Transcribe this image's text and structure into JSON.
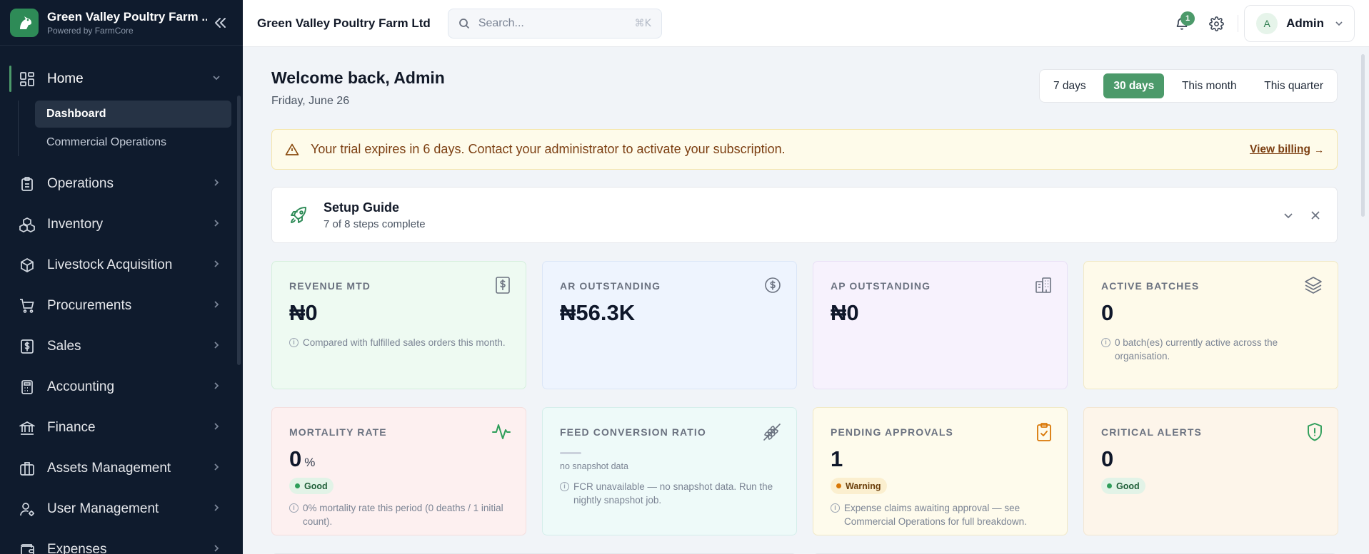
{
  "sidebar": {
    "brand_name": "Green Valley Poultry Farm ...",
    "brand_sub": "Powered by FarmCore",
    "items": [
      {
        "label": "Home"
      },
      {
        "label": "Operations"
      },
      {
        "label": "Inventory"
      },
      {
        "label": "Livestock Acquisition"
      },
      {
        "label": "Procurements"
      },
      {
        "label": "Sales"
      },
      {
        "label": "Accounting"
      },
      {
        "label": "Finance"
      },
      {
        "label": "Assets Management"
      },
      {
        "label": "User Management"
      },
      {
        "label": "Expenses"
      }
    ],
    "home_sub": [
      {
        "label": "Dashboard"
      },
      {
        "label": "Commercial Operations"
      }
    ]
  },
  "topbar": {
    "org_name": "Green Valley Poultry Farm Ltd",
    "search_placeholder": "Search...",
    "shortcut": "⌘K",
    "notification_count": "1",
    "avatar_initial": "A",
    "user_name": "Admin"
  },
  "welcome": {
    "title": "Welcome back, Admin",
    "date": "Friday, June 26"
  },
  "range": {
    "options": [
      "7 days",
      "30 days",
      "This month",
      "This quarter"
    ],
    "selected": "30 days"
  },
  "trial": {
    "message": "Your trial expires in 6 days. Contact your administrator to activate your subscription.",
    "link": "View billing",
    "arrow": "→"
  },
  "guide": {
    "title": "Setup Guide",
    "subtitle": "7 of 8 steps complete"
  },
  "cards": [
    {
      "label": "REVENUE MTD",
      "value": "₦0",
      "note": "Compared with fulfilled sales orders this month.",
      "icon": "receipt-icon"
    },
    {
      "label": "AR OUTSTANDING",
      "value": "₦56.3K",
      "icon": "dollar-circle-icon"
    },
    {
      "label": "AP OUTSTANDING",
      "value": "₦0",
      "icon": "building-icon"
    },
    {
      "label": "ACTIVE BATCHES",
      "value": "0",
      "note": "0 batch(es) currently active across the organisation.",
      "icon": "layers-icon"
    },
    {
      "label": "MORTALITY RATE",
      "value": "0",
      "unit": "%",
      "pill": "Good",
      "note": "0% mortality rate this period (0 deaths / 1 initial count).",
      "icon": "activity-icon"
    },
    {
      "label": "FEED CONVERSION RATIO",
      "sub": "no snapshot data",
      "note": "FCR unavailable — no snapshot data. Run the nightly snapshot job.",
      "icon": "wheat-icon"
    },
    {
      "label": "PENDING APPROVALS",
      "value": "1",
      "pill": "Warning",
      "note": "Expense claims awaiting approval — see Commercial Operations for full breakdown.",
      "icon": "clipboard-check-icon"
    },
    {
      "label": "CRITICAL ALERTS",
      "value": "0",
      "pill": "Good",
      "icon": "shield-alert-icon"
    }
  ],
  "colors": {
    "sidebar_bg": "#0f1b2d",
    "accent": "#4c9a6a",
    "trial_bg": "#fefbea"
  }
}
